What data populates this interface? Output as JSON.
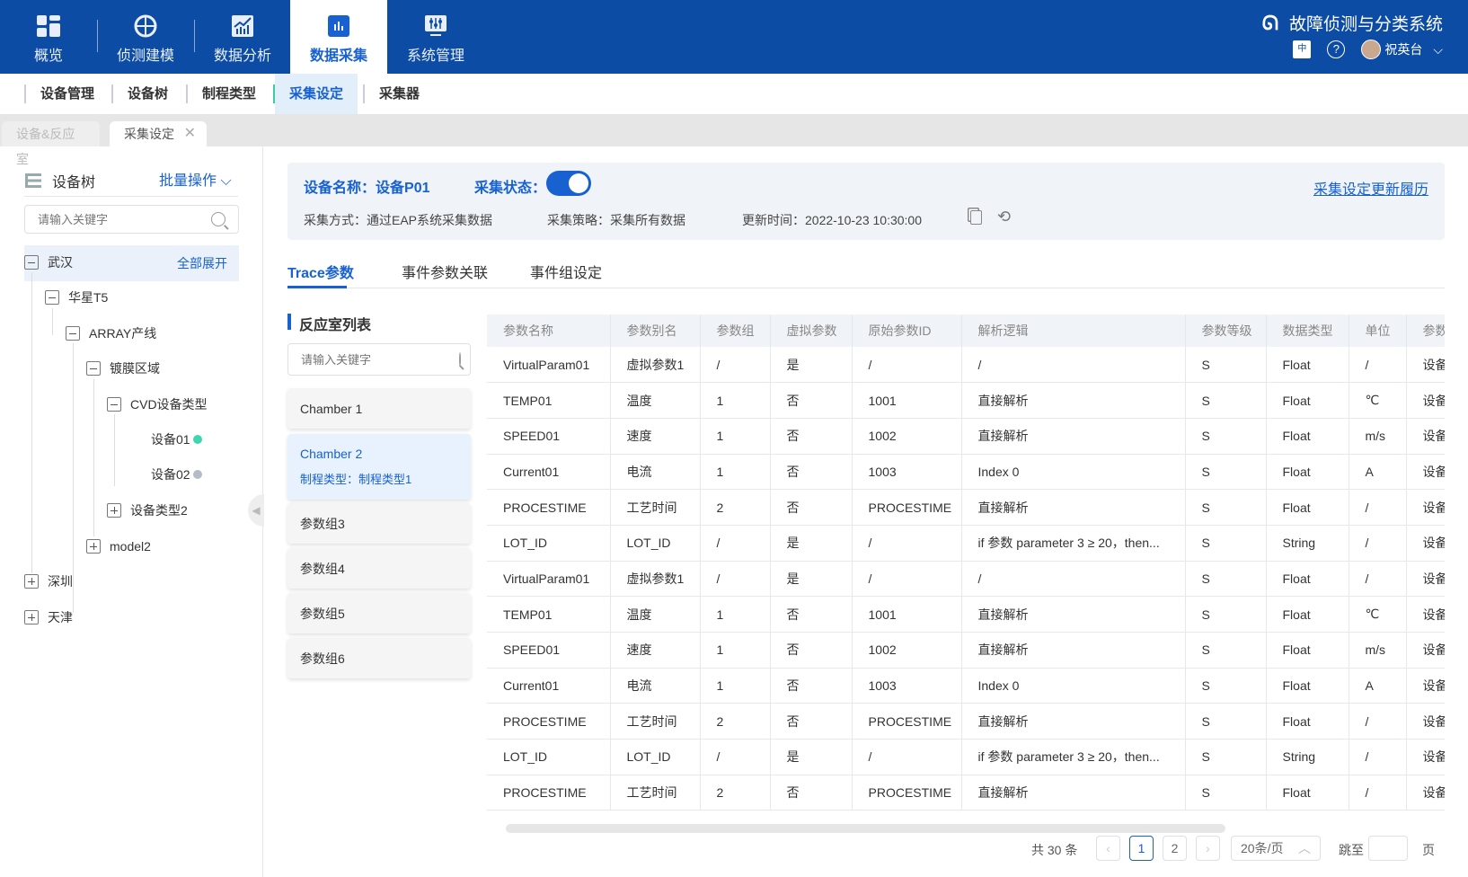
{
  "header": {
    "app_title": "故障侦测与分类系统",
    "user": "祝英台",
    "nav": [
      {
        "label": "概览",
        "icon": "grid-icon"
      },
      {
        "label": "侦测建模",
        "icon": "target-icon"
      },
      {
        "label": "数据分析",
        "icon": "chart-icon"
      },
      {
        "label": "数据采集",
        "icon": "bar-chart-icon",
        "active": true
      },
      {
        "label": "系统管理",
        "icon": "sliders-icon"
      }
    ]
  },
  "subnav": [
    {
      "label": "设备管理"
    },
    {
      "label": "设备树"
    },
    {
      "label": "制程类型"
    },
    {
      "label": "采集设定",
      "active": true
    },
    {
      "label": "采集器"
    }
  ],
  "page_tabs": [
    {
      "label": "设备&反应室"
    },
    {
      "label": "采集设定",
      "active": true
    }
  ],
  "tree": {
    "title": "设备树",
    "batch": "批量操作",
    "search_placeholder": "请输入关键字",
    "expand_all": "全部展开",
    "nodes": [
      "武汉",
      "华星T5",
      "ARRAY产线",
      "镀膜区域",
      "CVD设备类型",
      "设备01",
      "设备02",
      "设备类型2",
      "model2",
      "深圳",
      "天津"
    ],
    "status_colors": {
      "online": "#3dd6b0",
      "offline": "#b5bcc8"
    }
  },
  "info": {
    "device_name_label": "设备名称：",
    "device_name": "设备P01",
    "status_label": "采集状态：",
    "status_on": true,
    "method": "采集方式：通过EAP系统采集数据",
    "strategy": "采集策略：采集所有数据",
    "update_time": "更新时间：2022-10-23 10:30:00",
    "history_link": "采集设定更新履历"
  },
  "tabs": [
    {
      "label": "Trace参数",
      "active": true
    },
    {
      "label": "事件参数关联"
    },
    {
      "label": "事件组设定"
    }
  ],
  "chambers": {
    "title": "反应室列表",
    "search_placeholder": "请输入关键字",
    "items": [
      {
        "name": "Chamber 1"
      },
      {
        "name": "Chamber 2",
        "sub": "制程类型：制程类型1",
        "active": true
      },
      {
        "name": "参数组3"
      },
      {
        "name": "参数组4"
      },
      {
        "name": "参数组5"
      },
      {
        "name": "参数组6"
      }
    ]
  },
  "table": {
    "columns": [
      "参数名称",
      "参数别名",
      "参数组",
      "虚拟参数",
      "原始参数ID",
      "解析逻辑",
      "参数等级",
      "数据类型",
      "单位",
      "参数"
    ],
    "rows": [
      [
        "VirtualParam01",
        "虚拟参数1",
        "/",
        "是",
        "/",
        "/",
        "S",
        "Float",
        "/",
        "设备"
      ],
      [
        "TEMP01",
        "温度",
        "1",
        "否",
        "1001",
        "直接解析",
        "S",
        "Float",
        "℃",
        "设备"
      ],
      [
        "SPEED01",
        "速度",
        "1",
        "否",
        "1002",
        "直接解析",
        "S",
        "Float",
        "m/s",
        "设备"
      ],
      [
        "Current01",
        "电流",
        "1",
        "否",
        "1003",
        "Index 0",
        "S",
        "Float",
        "A",
        "设备"
      ],
      [
        "PROCESTIME",
        "工艺时间",
        "2",
        "否",
        "PROCESTIME",
        "直接解析",
        "S",
        "Float",
        "/",
        "设备"
      ],
      [
        "LOT_ID",
        "LOT_ID",
        "/",
        "是",
        "/",
        "if 参数 parameter 3 ≥ 20，then...",
        "S",
        "String",
        "/",
        "设备"
      ],
      [
        "VirtualParam01",
        "虚拟参数1",
        "/",
        "是",
        "/",
        "/",
        "S",
        "Float",
        "/",
        "设备"
      ],
      [
        "TEMP01",
        "温度",
        "1",
        "否",
        "1001",
        "直接解析",
        "S",
        "Float",
        "℃",
        "设备"
      ],
      [
        "SPEED01",
        "速度",
        "1",
        "否",
        "1002",
        "直接解析",
        "S",
        "Float",
        "m/s",
        "设备"
      ],
      [
        "Current01",
        "电流",
        "1",
        "否",
        "1003",
        "Index 0",
        "S",
        "Float",
        "A",
        "设备"
      ],
      [
        "PROCESTIME",
        "工艺时间",
        "2",
        "否",
        "PROCESTIME",
        "直接解析",
        "S",
        "Float",
        "/",
        "设备"
      ],
      [
        "LOT_ID",
        "LOT_ID",
        "/",
        "是",
        "/",
        "if 参数 parameter 3 ≥ 20，then...",
        "S",
        "String",
        "/",
        "设备"
      ],
      [
        "PROCESTIME",
        "工艺时间",
        "2",
        "否",
        "PROCESTIME",
        "直接解析",
        "S",
        "Float",
        "/",
        "设备"
      ]
    ]
  },
  "pagination": {
    "total": "共 30 条",
    "pages": [
      "1",
      "2"
    ],
    "current": "1",
    "page_size": "20条/页",
    "jump_label": "跳至",
    "page_suffix": "页"
  },
  "colors": {
    "primary": "#1761d1",
    "header_bg": "#0d4ca5"
  }
}
